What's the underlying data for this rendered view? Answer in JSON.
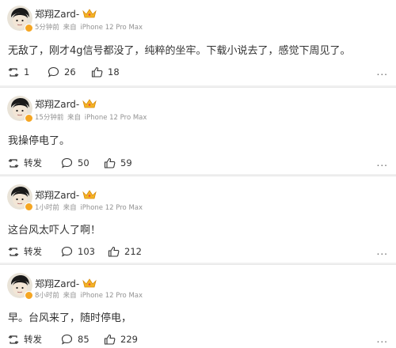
{
  "posts": [
    {
      "user": "郑翔Zard-",
      "time": "5分钟前",
      "source_prefix": "来自",
      "source": "iPhone 12 Pro Max",
      "text": "无敌了，刚才4g信号都没了，纯粹的坐牢。下载小说去了，感觉下周见了。",
      "repost": "1",
      "comments": "26",
      "likes": "18"
    },
    {
      "user": "郑翔Zard-",
      "time": "15分钟前",
      "source_prefix": "来自",
      "source": "iPhone 12 Pro Max",
      "text": "我操停电了。",
      "repost": "转发",
      "comments": "50",
      "likes": "59"
    },
    {
      "user": "郑翔Zard-",
      "time": "1小时前",
      "source_prefix": "来自",
      "source": "iPhone 12 Pro Max",
      "text": "这台风太吓人了啊！",
      "repost": "转发",
      "comments": "103",
      "likes": "212"
    },
    {
      "user": "郑翔Zard-",
      "time": "8小时前",
      "source_prefix": "来自",
      "source": "iPhone 12 Pro Max",
      "text": "早。台风来了，随时停电，",
      "repost": "转发",
      "comments": "85",
      "likes": "229"
    }
  ],
  "more_label": "...",
  "icons": {
    "repost": "repost-icon",
    "comment": "comment-icon",
    "like": "thumbs-up-icon",
    "verified": "verified-badge-icon",
    "crown": "crown-icon"
  },
  "colors": {
    "verified": "#f5a623",
    "meta_text": "#939393",
    "text": "#333333"
  }
}
